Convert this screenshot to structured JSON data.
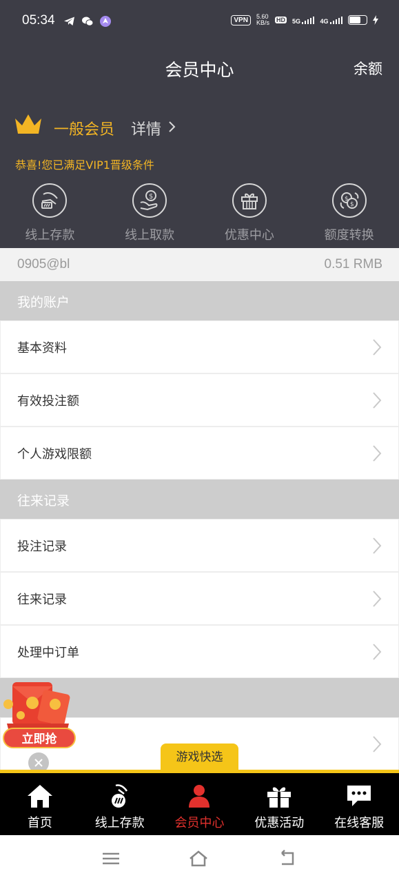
{
  "status_bar": {
    "time": "05:34",
    "vpn": "VPN",
    "net_speed_value": "5.60",
    "net_speed_unit": "KB/s",
    "hd": "HD",
    "sim1_label": "5G",
    "sim2_label": "4G"
  },
  "header": {
    "title": "会员中心",
    "balance_label": "余额"
  },
  "member": {
    "level": "一般会员",
    "detail": "详情",
    "notice": "恭喜!您已满足VIP1晋级条件"
  },
  "quick_actions": [
    {
      "label": "线上存款",
      "icon": "deposit-icon"
    },
    {
      "label": "线上取款",
      "icon": "withdraw-icon"
    },
    {
      "label": "优惠中心",
      "icon": "gift-icon"
    },
    {
      "label": "额度转换",
      "icon": "exchange-icon"
    }
  ],
  "account": {
    "username": "0905@bl",
    "balance": "0.51 RMB"
  },
  "sections": [
    {
      "title": "我的账户",
      "items": [
        "基本资料",
        "有效投注额",
        "个人游戏限额"
      ]
    },
    {
      "title": "往来记录",
      "items": [
        "投注记录",
        "往来记录",
        "处理中订单"
      ]
    }
  ],
  "promo": {
    "label": "立即抢"
  },
  "game_quick": "游戏快选",
  "tabs": [
    {
      "label": "首页",
      "icon": "home-icon"
    },
    {
      "label": "线上存款",
      "icon": "deposit-icon"
    },
    {
      "label": "会员中心",
      "icon": "member-icon"
    },
    {
      "label": "优惠活动",
      "icon": "gift-icon"
    },
    {
      "label": "在线客服",
      "icon": "chat-icon"
    }
  ],
  "colors": {
    "header_bg": "#3d3d46",
    "accent_gold": "#f3b524",
    "active_tab": "#e3312d",
    "section_bg": "#cdcdcd"
  }
}
